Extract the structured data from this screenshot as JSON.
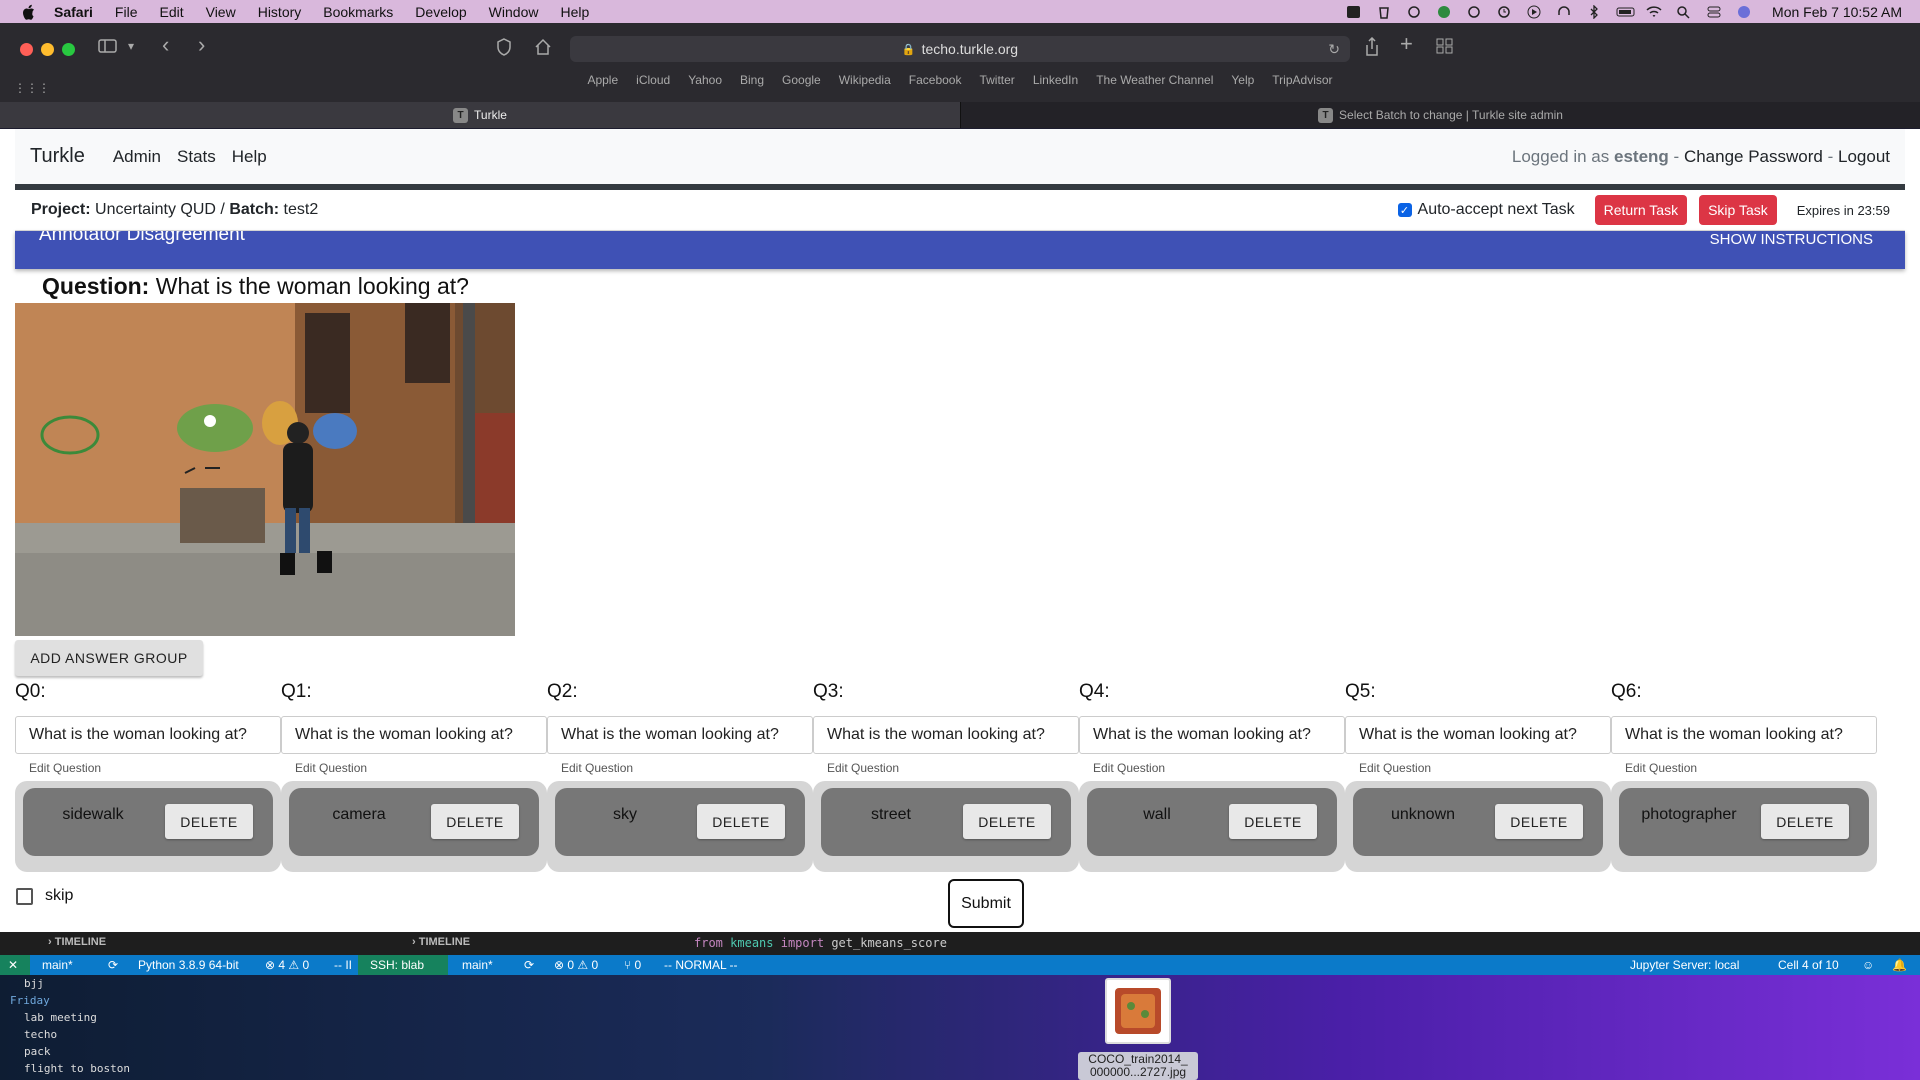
{
  "menubar": {
    "app": "Safari",
    "items": [
      "File",
      "Edit",
      "View",
      "History",
      "Bookmarks",
      "Develop",
      "Window",
      "Help"
    ],
    "clock": "Mon Feb 7  10:52 AM"
  },
  "browser": {
    "url": "techo.turkle.org",
    "favorites": [
      "Apple",
      "iCloud",
      "Yahoo",
      "Bing",
      "Google",
      "Wikipedia",
      "Facebook",
      "Twitter",
      "LinkedIn",
      "The Weather Channel",
      "Yelp",
      "TripAdvisor"
    ],
    "tabs": [
      {
        "label": "Turkle",
        "favicon": "T"
      },
      {
        "label": "Select Batch to change | Turkle site admin",
        "favicon": "T"
      }
    ]
  },
  "nav": {
    "brand": "Turkle",
    "links": [
      "Admin",
      "Stats",
      "Help"
    ],
    "logged_in_prefix": "Logged in as",
    "username": "esteng",
    "change_password": "Change Password",
    "logout": "Logout",
    "sep": "-"
  },
  "project_bar": {
    "project_label": "Project:",
    "project": "Uncertainty QUD",
    "slash": "/",
    "batch_label": "Batch:",
    "batch": "test2",
    "auto_accept": "Auto-accept next Task",
    "auto_accept_checked": true,
    "return_task": "Return Task",
    "skip_task": "Skip Task",
    "expires": "Expires in 23:59"
  },
  "banner": {
    "title": "Annotator Disagreement",
    "show_instructions": "SHOW INSTRUCTIONS"
  },
  "question": {
    "label": "Question:",
    "text": "What is the woman looking at?"
  },
  "add_answer_group": "ADD ANSWER GROUP",
  "groups": [
    {
      "label": "Q0:",
      "question": "What is the woman looking at?",
      "help": "Edit Question",
      "answer": "sidewalk",
      "delete": "DELETE"
    },
    {
      "label": "Q1:",
      "question": "What is the woman looking at?",
      "help": "Edit Question",
      "answer": "camera",
      "delete": "DELETE"
    },
    {
      "label": "Q2:",
      "question": "What is the woman looking at?",
      "help": "Edit Question",
      "answer": "sky",
      "delete": "DELETE"
    },
    {
      "label": "Q3:",
      "question": "What is the woman looking at?",
      "help": "Edit Question",
      "answer": "street",
      "delete": "DELETE"
    },
    {
      "label": "Q4:",
      "question": "What is the woman looking at?",
      "help": "Edit Question",
      "answer": "wall",
      "delete": "DELETE"
    },
    {
      "label": "Q5:",
      "question": "What is the woman looking at?",
      "help": "Edit Question",
      "answer": "unknown",
      "delete": "DELETE"
    },
    {
      "label": "Q6:",
      "question": "What is the woman looking at?",
      "help": "Edit Question",
      "answer": "photographer",
      "delete": "DELETE"
    }
  ],
  "skip_label": "skip",
  "submit_label": "Submit",
  "editor": {
    "timeline": "TIMELINE",
    "code_kw1": "from",
    "code_mod": "kmeans",
    "code_kw2": "import",
    "code_fn": "get_kmeans_score",
    "status_left": [
      "main*",
      "Python 3.8.9 64-bit",
      "⊗ 4 ⚠ 0",
      "-- II"
    ],
    "status_mid": [
      "SSH: blab",
      "main*",
      "⊗ 0 ⚠ 0",
      "⑂ 0",
      "-- NORMAL --"
    ],
    "jupyter": "Jupyter Server: local",
    "cell": "Cell 4 of 10"
  },
  "todo": {
    "lines": [
      "bjj"
    ],
    "day": "Friday",
    "items": [
      "lab meeting",
      "techo",
      "pack",
      "flight to boston"
    ]
  },
  "desktop_file": {
    "name_line1": "COCO_train2014_",
    "name_line2": "000000...2727.jpg"
  }
}
